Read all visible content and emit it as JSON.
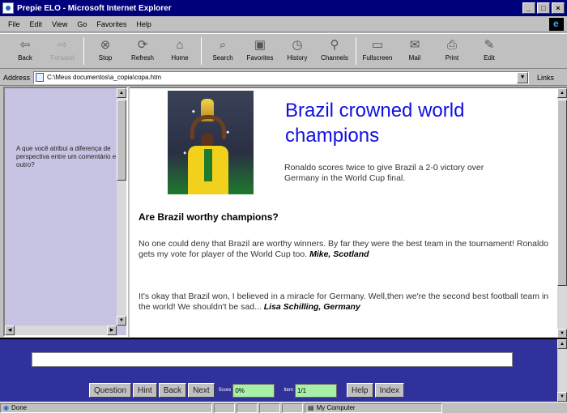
{
  "window": {
    "title": "Prepie ELO - Microsoft Internet Explorer"
  },
  "menus": [
    "File",
    "Edit",
    "View",
    "Go",
    "Favorites",
    "Help"
  ],
  "toolbar": [
    {
      "label": "Back",
      "icon": "back-arrow-icon",
      "glyph": "⇦",
      "disabled": false
    },
    {
      "label": "Forward",
      "icon": "forward-arrow-icon",
      "glyph": "⇨",
      "disabled": true
    },
    {
      "label": "Stop",
      "icon": "stop-icon",
      "glyph": "⊗",
      "disabled": false
    },
    {
      "label": "Refresh",
      "icon": "refresh-icon",
      "glyph": "⟳",
      "disabled": false
    },
    {
      "label": "Home",
      "icon": "home-icon",
      "glyph": "⌂",
      "disabled": false
    },
    {
      "label": "Search",
      "icon": "search-icon",
      "glyph": "⌕",
      "disabled": false
    },
    {
      "label": "Favorites",
      "icon": "favorites-icon",
      "glyph": "▣",
      "disabled": false
    },
    {
      "label": "History",
      "icon": "history-icon",
      "glyph": "◷",
      "disabled": false
    },
    {
      "label": "Channels",
      "icon": "channels-icon",
      "glyph": "⚲",
      "disabled": false
    },
    {
      "label": "Fullscreen",
      "icon": "fullscreen-icon",
      "glyph": "▭",
      "disabled": false
    },
    {
      "label": "Mail",
      "icon": "mail-icon",
      "glyph": "✉",
      "disabled": false
    },
    {
      "label": "Print",
      "icon": "print-icon",
      "glyph": "⎙",
      "disabled": false
    },
    {
      "label": "Edit",
      "icon": "edit-icon",
      "glyph": "✎",
      "disabled": false
    }
  ],
  "address": {
    "label": "Address",
    "value": "C:\\Meus documentos\\a_copia\\copa.htm",
    "links_label": "Links"
  },
  "left_frame": {
    "prompt": "A que você atribui a diferença de perspectiva entre um comentário e outro?"
  },
  "article": {
    "headline": "Brazil crowned world champions",
    "subhead": "Ronaldo scores twice to give Brazil a 2-0 victory over Germany in the World Cup final.",
    "question": "Are Brazil worthy champions?",
    "comments": [
      {
        "text": "No one could deny that Brazil are worthy winners. By far they were the best team in the tournament! Ronaldo gets my vote for player of the World Cup too.",
        "author": "Mike, Scotland"
      },
      {
        "text": "It's okay that Brazil won, I believed in a miracle for Germany. Well,then we're the second best football team in the world! We shouldn't be sad...",
        "author": "Lisa Schilling, Germany"
      }
    ]
  },
  "bottom_panel": {
    "answer_value": "",
    "buttons": {
      "question": "Question",
      "hint": "Hint",
      "back": "Back",
      "next": "Next",
      "help": "Help",
      "index": "Index"
    },
    "score_label": "Score",
    "score_value": "0%",
    "item_label": "Item",
    "item_value": "1/1"
  },
  "status": {
    "text": "Done",
    "zone": "My Computer"
  },
  "colors": {
    "title_bar": "#00007b",
    "headline": "#1010e0",
    "left_frame_bg": "#c7c3e3",
    "bottom_panel_bg": "#31319c",
    "field_bg": "#a8f0a8"
  }
}
